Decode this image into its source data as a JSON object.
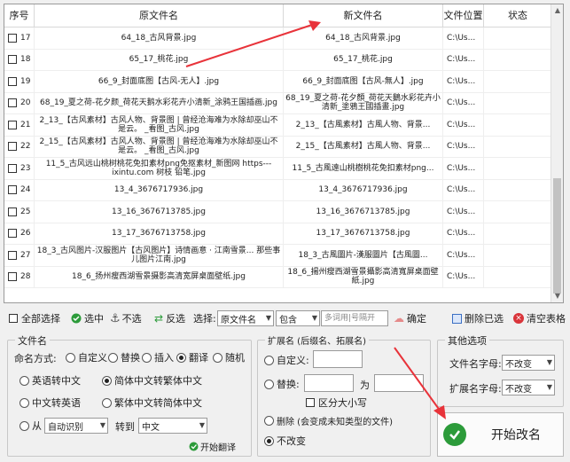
{
  "headers": [
    "序号",
    "原文件名",
    "新文件名",
    "文件位置",
    "状态"
  ],
  "rows": [
    {
      "no": "17",
      "orig": "64_18_古风背景.jpg",
      "new": "64_18_古风背景.jpg",
      "loc": "C:\\Us...",
      "status": ""
    },
    {
      "no": "18",
      "orig": "65_17_桃花.jpg",
      "new": "65_17_桃花.jpg",
      "loc": "C:\\Us...",
      "status": ""
    },
    {
      "no": "19",
      "orig": "66_9_封面底图【古风-无人】.jpg",
      "new": "66_9_封面底图【古风-無人】.jpg",
      "loc": "C:\\Us...",
      "status": ""
    },
    {
      "no": "20",
      "orig": "68_19_夏之荷-花夕颜_荷花天鹅水彩花卉小清新_涂鸦王国插画.jpg",
      "new": "68_19_夏之荷-花夕顏_荷花天鵝水彩花卉小清新_塗鴉王國插畫.jpg",
      "loc": "C:\\Us...",
      "status": ""
    },
    {
      "no": "21",
      "orig": "2_13_【古风素材】古风人物、背景图 | 曾经沧海难为水除却巫山不是云。 _看图_古风.jpg",
      "new": "2_13_【古風素材】古風人物、背景...",
      "loc": "C:\\Us...",
      "status": ""
    },
    {
      "no": "22",
      "orig": "2_15_【古风素材】古风人物、背景图 | 曾经沧海难为水除却巫山不是云。 _看图_古风.jpg",
      "new": "2_15_【古風素材】古風人物、背景...",
      "loc": "C:\\Us...",
      "status": ""
    },
    {
      "no": "23",
      "orig": "11_5_古风远山桃树桃花免扣素材png免抠素材_新图网 https---ixintu.com 树枝 铅笔.jpg",
      "new": "11_5_古風遠山桃樹桃花免扣素材png...",
      "loc": "C:\\Us...",
      "status": ""
    },
    {
      "no": "24",
      "orig": "13_4_3676717936.jpg",
      "new": "13_4_3676717936.jpg",
      "loc": "C:\\Us...",
      "status": ""
    },
    {
      "no": "25",
      "orig": "13_16_3676713785.jpg",
      "new": "13_16_3676713785.jpg",
      "loc": "C:\\Us...",
      "status": ""
    },
    {
      "no": "26",
      "orig": "13_17_3676713758.jpg",
      "new": "13_17_3676713758.jpg",
      "loc": "C:\\Us...",
      "status": ""
    },
    {
      "no": "27",
      "orig": "18_3_古风图片-汉服图片【古风图片】诗情画意 · 江南雪景... 那些事儿图片江南.jpg",
      "new": "18_3_古風圖片-漢服圖片【古風圖...",
      "loc": "C:\\Us...",
      "status": ""
    },
    {
      "no": "28",
      "orig": "18_6_扬州瘦西湖雪景摄影高清宽屏桌面壁纸.jpg",
      "new": "18_6_揚州瘦西湖雪景攝影高清寬屏桌面壁紙.jpg",
      "loc": "C:\\Us...",
      "status": ""
    }
  ],
  "toolbar": {
    "select_all": "全部选择",
    "select": "选中",
    "unselect": "不选",
    "invert": "反选",
    "choose_label": "选择:",
    "choose_field": "原文件名",
    "match": "包含",
    "filter_placeholder": "多词用|号隔开",
    "confirm": "确定",
    "delete_selected": "删除已选",
    "clear_table": "清空表格"
  },
  "filename_group": {
    "title": "文件名",
    "naming_label": "命名方式:",
    "modes": [
      "自定义",
      "替换",
      "插入",
      "翻译",
      "随机"
    ],
    "mode_selected": "翻译",
    "options": [
      "英语转中文",
      "简体中文转繁体中文",
      "中文转英语",
      "繁体中文转简体中文"
    ],
    "option_selected": "简体中文转繁体中文",
    "from_label": "从",
    "from_value": "自动识别",
    "to_label": "转到",
    "to_value": "中文",
    "start_translate": "开始翻译"
  },
  "ext_group": {
    "title": "扩展名 (后缀名、拓展名)",
    "custom_label": "自定义:",
    "replace_label": "替换:",
    "as_label": "为",
    "case_label": "区分大小写",
    "delete_label": "删除 (会变成未知类型的文件)",
    "nochange_label": "不改变"
  },
  "other_group": {
    "title": "其他选项",
    "filename_case_label": "文件名字母:",
    "filename_case_value": "不改变",
    "ext_case_label": "扩展名字母:",
    "ext_case_value": "不改变"
  },
  "start_button": "开始改名",
  "colors": {
    "arrow": "#e8333a",
    "start_icon": "#2c9b3a"
  }
}
